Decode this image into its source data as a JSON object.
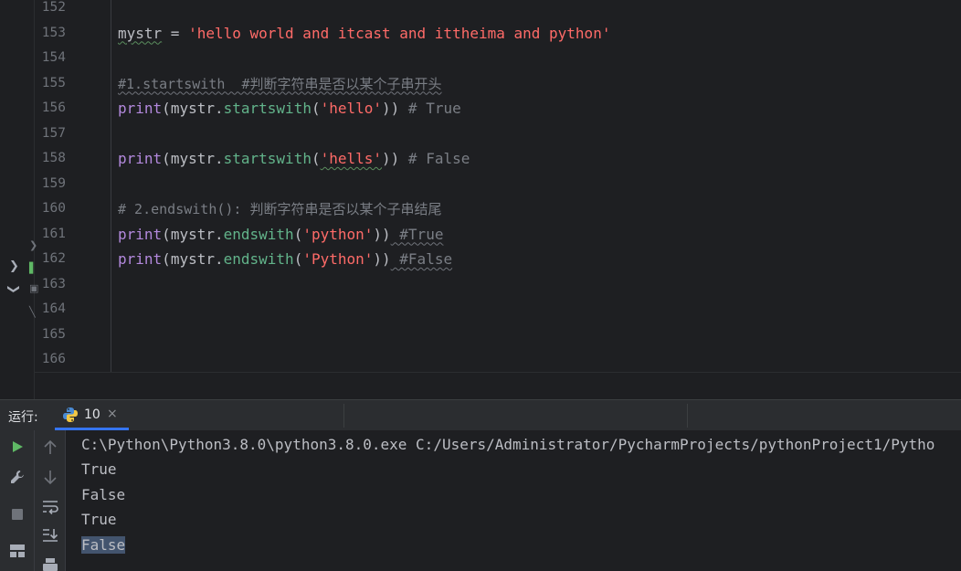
{
  "editor": {
    "line_numbers": [
      "152",
      "153",
      "154",
      "155",
      "156",
      "157",
      "158",
      "159",
      "160",
      "161",
      "162",
      "163",
      "164",
      "165",
      "166"
    ],
    "lines": {
      "l153": {
        "var": "mystr",
        "op": " = ",
        "string": "'hello world and itcast and ittheima and python'"
      },
      "l155": {
        "comment": "#1.startswith  #判断字符串是否以某个子串开头"
      },
      "l156": {
        "print": "print",
        "open": "(",
        "obj": "mystr",
        "dot": ".",
        "method": "startswith",
        "open2": "(",
        "arg": "'hello'",
        "close": "))",
        "comment": " # True"
      },
      "l158": {
        "print": "print",
        "open": "(",
        "obj": "mystr",
        "dot": ".",
        "method": "startswith",
        "open2": "(",
        "arg": "'hells'",
        "close": "))",
        "comment": " # False"
      },
      "l160": {
        "comment": "# 2.endswith(): 判断字符串是否以某个子串结尾"
      },
      "l161": {
        "print": "print",
        "open": "(",
        "obj": "mystr",
        "dot": ".",
        "method": "endswith",
        "open2": "(",
        "arg": "'python'",
        "close": "))",
        "comment": " #True"
      },
      "l162": {
        "print": "print",
        "open": "(",
        "obj": "mystr",
        "dot": ".",
        "method": "endswith",
        "open2": "(",
        "arg": "'Python'",
        "close": "))",
        "comment": " #False"
      }
    },
    "left_strip_icons": [
      "chevron-right-icon",
      "chevron-down-icon"
    ]
  },
  "run": {
    "label": "运行:",
    "tab": {
      "name": "10",
      "close": "×",
      "icon": "python-icon"
    },
    "left_toolbar": [
      "run-icon",
      "wrench-icon",
      "stop-icon",
      "layout-icon",
      "print-icon"
    ],
    "second_toolbar": [
      "arrow-up-icon",
      "arrow-down-icon",
      "soft-wrap-icon",
      "scroll-to-end-icon",
      "print-icon"
    ],
    "console_lines": [
      "C:\\Python\\Python3.8.0\\python3.8.0.exe C:/Users/Administrator/PycharmProjects/pythonProject1/Pytho",
      "True",
      "False",
      "True",
      "False"
    ]
  },
  "colors": {
    "background": "#1e1f22",
    "panel": "#2b2d30",
    "keyword": "#b389dd",
    "string": "#ff6b68",
    "method": "#56a8f5",
    "comment": "#7a7e85",
    "run_green": "#5fb865",
    "selection": "#43546e",
    "tab_underline": "#3574f0"
  }
}
